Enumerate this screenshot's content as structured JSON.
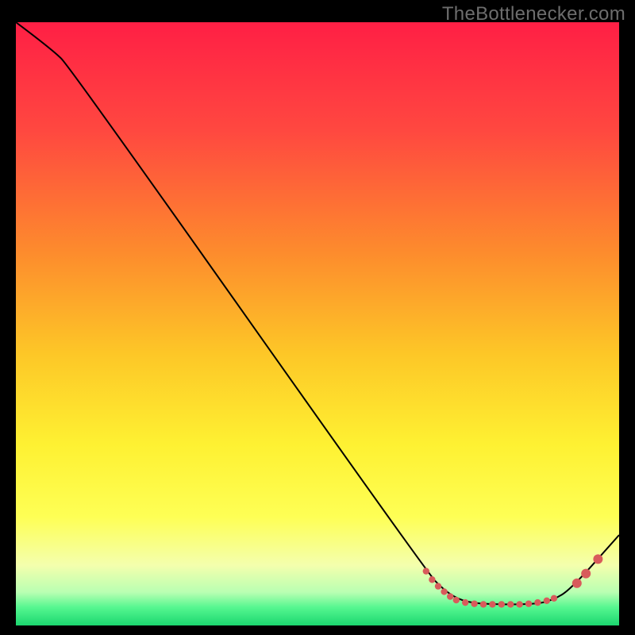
{
  "watermark": "TheBottlenecker.com",
  "chart_data": {
    "type": "line",
    "title": "",
    "xlabel": "",
    "ylabel": "",
    "xlim": [
      0,
      100
    ],
    "ylim": [
      0,
      100
    ],
    "grid": false,
    "background": {
      "type": "vertical_gradient",
      "stops": [
        {
          "offset": 0.0,
          "color": "#ff1f45"
        },
        {
          "offset": 0.18,
          "color": "#ff4840"
        },
        {
          "offset": 0.38,
          "color": "#fd8b2d"
        },
        {
          "offset": 0.55,
          "color": "#fdc727"
        },
        {
          "offset": 0.7,
          "color": "#fef132"
        },
        {
          "offset": 0.82,
          "color": "#feff55"
        },
        {
          "offset": 0.9,
          "color": "#f4ffad"
        },
        {
          "offset": 0.945,
          "color": "#b9ffb2"
        },
        {
          "offset": 0.97,
          "color": "#56f790"
        },
        {
          "offset": 1.0,
          "color": "#1bd66f"
        }
      ]
    },
    "series": [
      {
        "name": "bottleneck-curve",
        "color": "#000000",
        "points": [
          {
            "x": 0.0,
            "y": 100.0
          },
          {
            "x": 6.0,
            "y": 95.5
          },
          {
            "x": 9.0,
            "y": 92.5
          },
          {
            "x": 68.0,
            "y": 9.0
          },
          {
            "x": 71.0,
            "y": 5.8
          },
          {
            "x": 74.0,
            "y": 4.0
          },
          {
            "x": 78.0,
            "y": 3.5
          },
          {
            "x": 86.0,
            "y": 3.5
          },
          {
            "x": 89.0,
            "y": 4.2
          },
          {
            "x": 92.0,
            "y": 6.0
          },
          {
            "x": 100.0,
            "y": 15.0
          }
        ]
      }
    ],
    "markers": {
      "name": "highlight-band",
      "color": "#d85b5b",
      "radius_small": 4.2,
      "radius_big": 6.0,
      "points": [
        {
          "x": 68.0,
          "y": 9.0,
          "r": "small"
        },
        {
          "x": 69.0,
          "y": 7.6,
          "r": "small"
        },
        {
          "x": 70.0,
          "y": 6.5,
          "r": "small"
        },
        {
          "x": 71.0,
          "y": 5.6,
          "r": "small"
        },
        {
          "x": 72.0,
          "y": 4.8,
          "r": "small"
        },
        {
          "x": 73.0,
          "y": 4.2,
          "r": "small"
        },
        {
          "x": 74.5,
          "y": 3.8,
          "r": "small"
        },
        {
          "x": 76.0,
          "y": 3.6,
          "r": "small"
        },
        {
          "x": 77.5,
          "y": 3.5,
          "r": "small"
        },
        {
          "x": 79.0,
          "y": 3.5,
          "r": "small"
        },
        {
          "x": 80.5,
          "y": 3.5,
          "r": "small"
        },
        {
          "x": 82.0,
          "y": 3.5,
          "r": "small"
        },
        {
          "x": 83.5,
          "y": 3.5,
          "r": "small"
        },
        {
          "x": 85.0,
          "y": 3.6,
          "r": "small"
        },
        {
          "x": 86.5,
          "y": 3.8,
          "r": "small"
        },
        {
          "x": 88.0,
          "y": 4.1,
          "r": "small"
        },
        {
          "x": 89.2,
          "y": 4.5,
          "r": "small"
        },
        {
          "x": 93.0,
          "y": 7.0,
          "r": "big"
        },
        {
          "x": 94.5,
          "y": 8.6,
          "r": "big"
        },
        {
          "x": 96.5,
          "y": 11.0,
          "r": "big"
        }
      ]
    }
  }
}
